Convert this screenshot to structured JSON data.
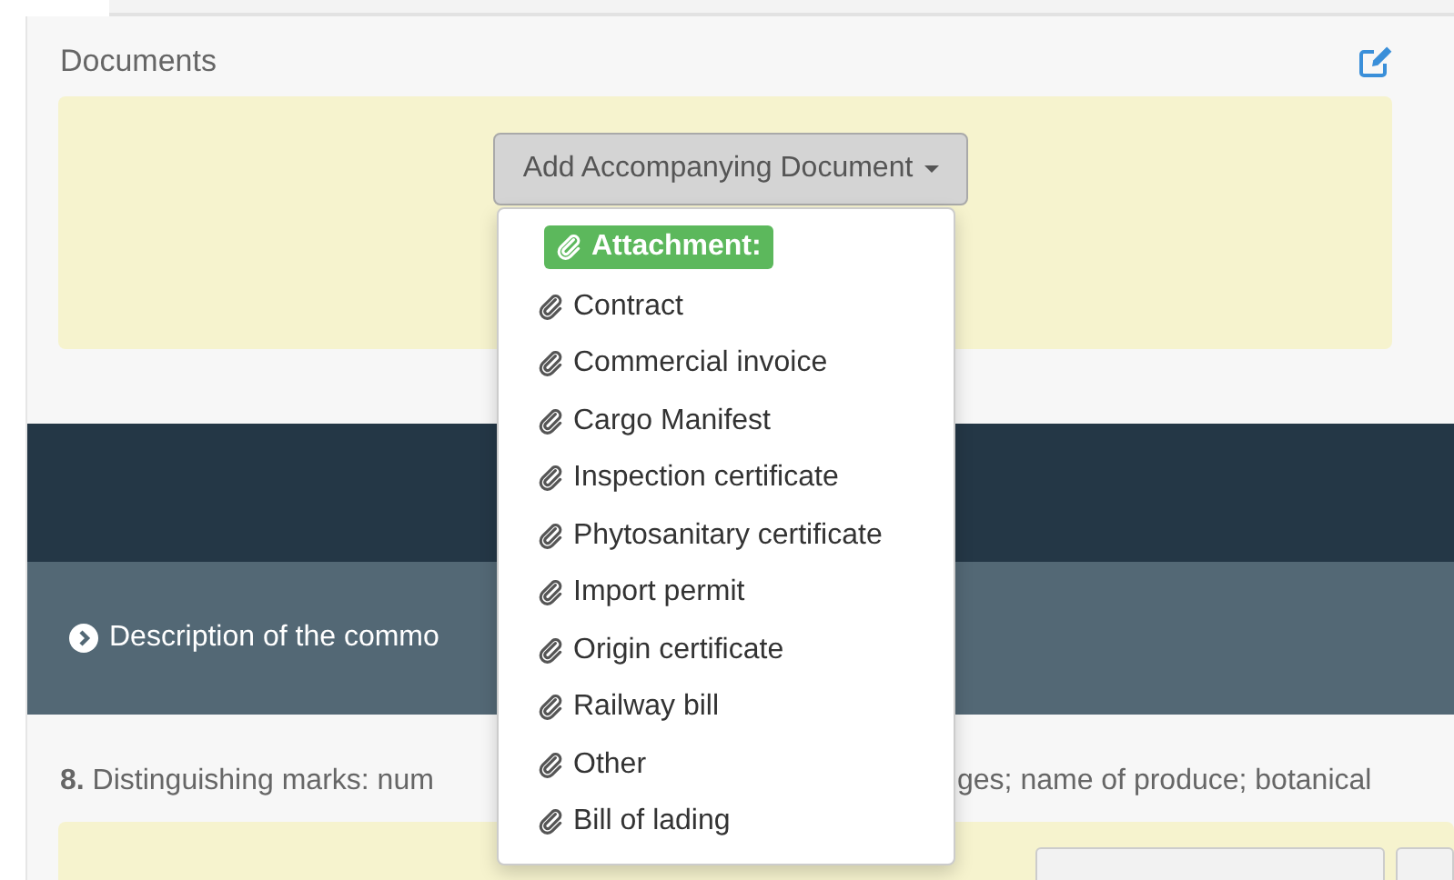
{
  "documents": {
    "title": "Documents",
    "add_button": "Add Accompanying Document",
    "menu": [
      {
        "label": "Attachment:",
        "kind": "header"
      },
      {
        "label": "Contract",
        "kind": "item"
      },
      {
        "label": "Commercial invoice",
        "kind": "item"
      },
      {
        "label": "Cargo Manifest",
        "kind": "item"
      },
      {
        "label": "Inspection certificate",
        "kind": "item"
      },
      {
        "label": "Phytosanitary certificate",
        "kind": "item"
      },
      {
        "label": "Import permit",
        "kind": "item"
      },
      {
        "label": "Origin certificate",
        "kind": "item"
      },
      {
        "label": "Railway bill",
        "kind": "item"
      },
      {
        "label": "Other",
        "kind": "item"
      },
      {
        "label": "Bill of lading",
        "kind": "item"
      }
    ]
  },
  "commodity_section": {
    "title": "Description of the commo"
  },
  "field_8": {
    "label_left": "**8.** Distinguishing marks: num",
    "label_right": "ges; name of produce; botanical"
  }
}
